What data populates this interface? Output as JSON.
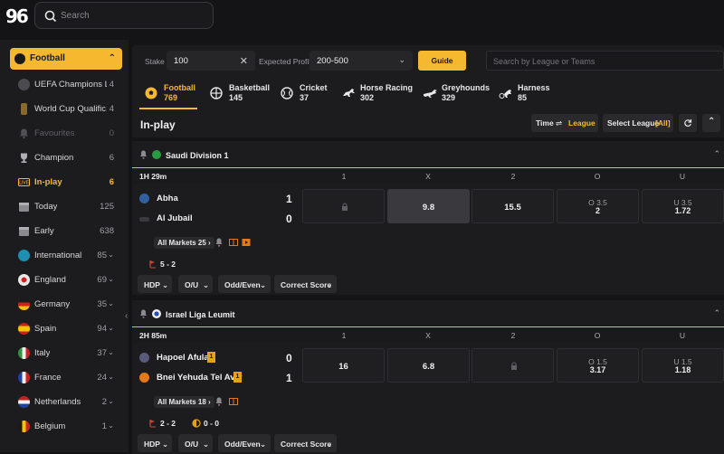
{
  "header": {
    "logo": "96",
    "search_placeholder": "Search"
  },
  "sidebar": {
    "sport_label": "Football",
    "items": [
      {
        "label": "UEFA Champions L...",
        "count": "4",
        "icon_color": "#3a3a3e"
      },
      {
        "label": "World Cup Qualific...",
        "count": "4",
        "icon_color": "#8a6a2a"
      },
      {
        "label": "Favourites",
        "count": "0",
        "icon_color": "#3a3a3e"
      },
      {
        "label": "Champion",
        "count": "6",
        "icon_color": "#3a3a3e"
      },
      {
        "label": "In-play",
        "count": "6",
        "icon_color": "#f5b82e"
      },
      {
        "label": "Today",
        "count": "125",
        "icon_color": "#3a3a3e"
      },
      {
        "label": "Early",
        "count": "638",
        "icon_color": "#3a3a3e"
      },
      {
        "label": "International",
        "count": "85",
        "icon_color": "#1e8fb0"
      },
      {
        "label": "England",
        "count": "69",
        "icon_color": "#d0d0d0"
      },
      {
        "label": "Germany",
        "count": "35",
        "icon_color": "#d02020"
      },
      {
        "label": "Spain",
        "count": "94",
        "icon_color": "#e0a000"
      },
      {
        "label": "Italy",
        "count": "37",
        "icon_color": "#30a040"
      },
      {
        "label": "France",
        "count": "24",
        "icon_color": "#2040c0"
      },
      {
        "label": "Netherlands",
        "count": "2",
        "icon_color": "#d03030"
      },
      {
        "label": "Belgium",
        "count": "1",
        "icon_color": "#e0c000"
      }
    ]
  },
  "filters": {
    "stake_label": "Stake",
    "stake_value": "100",
    "profit_label": "Expected Profit",
    "profit_value": "200-500",
    "guide_label": "Guide details",
    "league_search_placeholder": "Search by League or Teams"
  },
  "sports": [
    {
      "name": "Football",
      "count": "769"
    },
    {
      "name": "Basketball",
      "count": "145"
    },
    {
      "name": "Cricket",
      "count": "37"
    },
    {
      "name": "Horse Racing",
      "count": "302"
    },
    {
      "name": "Greyhounds",
      "count": "329"
    },
    {
      "name": "Harness",
      "count": "85"
    }
  ],
  "inplay": {
    "title": "In-play",
    "time_label": "Time",
    "league_label": "League",
    "select_league_label": "Select League",
    "select_league_value": "[All]"
  },
  "columns": [
    "1",
    "X",
    "2",
    "O",
    "U"
  ],
  "leagues": [
    {
      "name": "Saudi Division 1",
      "time": "1H 29m",
      "home": "Abha",
      "away": "Al Jubail",
      "home_score": "1",
      "away_score": "0",
      "odds": {
        "home": "",
        "draw": "9.8",
        "away": "15.5",
        "over_line": "O 3.5",
        "over_odds": "2",
        "under_line": "U 3.5",
        "under_odds": "1.72"
      },
      "all_markets": "All Markets 25",
      "stat_corner": "5 - 2",
      "stat_card": ""
    },
    {
      "name": "Israel Liga Leumit",
      "time": "2H 85m",
      "home": "Hapoel Afula",
      "away": "Bnei Yehuda Tel Aviv",
      "home_red": "1",
      "away_red": "1",
      "home_score": "0",
      "away_score": "1",
      "odds": {
        "home": "16",
        "draw": "6.8",
        "away": "",
        "over_line": "O 1.5",
        "over_odds": "3.17",
        "under_line": "U 1.5",
        "under_odds": "1.18"
      },
      "all_markets": "All Markets 18",
      "stat_corner": "2 - 2",
      "stat_card": "0 - 0"
    }
  ],
  "market_tabs": [
    "HDP",
    "O/U",
    "Odd/Even",
    "Correct Score"
  ]
}
